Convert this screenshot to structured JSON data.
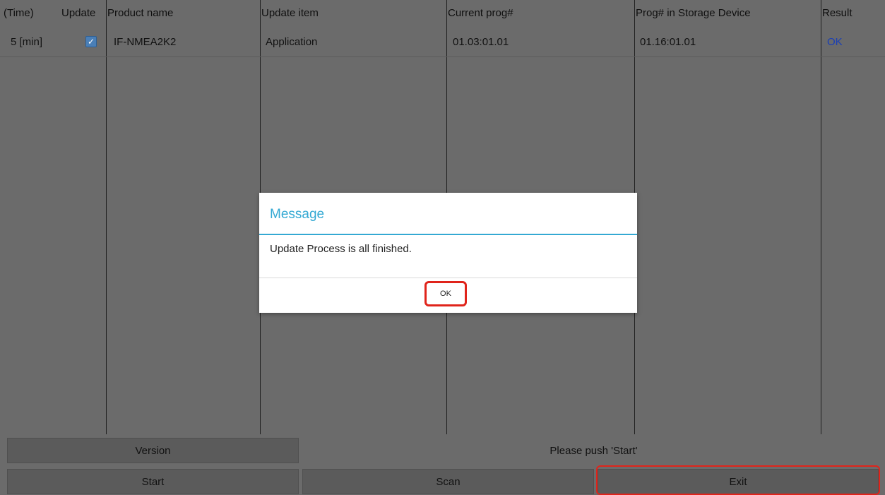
{
  "table": {
    "headers": {
      "time": "(Time)",
      "update": "Update",
      "product_name": "Product name",
      "update_item": "Update item",
      "current_prog": "Current prog#",
      "prog_storage": "Prog# in Storage Device",
      "result": "Result"
    },
    "rows": [
      {
        "time": "5 [min]",
        "update_checked": true,
        "product_name": "IF-NMEA2K2",
        "update_item": "Application",
        "current_prog": "01.03:01.01",
        "prog_storage": "01.16:01.01",
        "result": "OK"
      }
    ]
  },
  "buttons": {
    "version": "Version",
    "start": "Start",
    "scan": "Scan",
    "exit": "Exit"
  },
  "status_text": "Please push 'Start'",
  "dialog": {
    "title": "Message",
    "message": "Update Process is all finished.",
    "ok": "OK"
  },
  "colors": {
    "dialog_accent": "#34a9d3",
    "highlight": "#e0241b",
    "result_ok": "#1a3fb4"
  },
  "icons": {
    "update_checkbox": "checkmark-icon"
  }
}
